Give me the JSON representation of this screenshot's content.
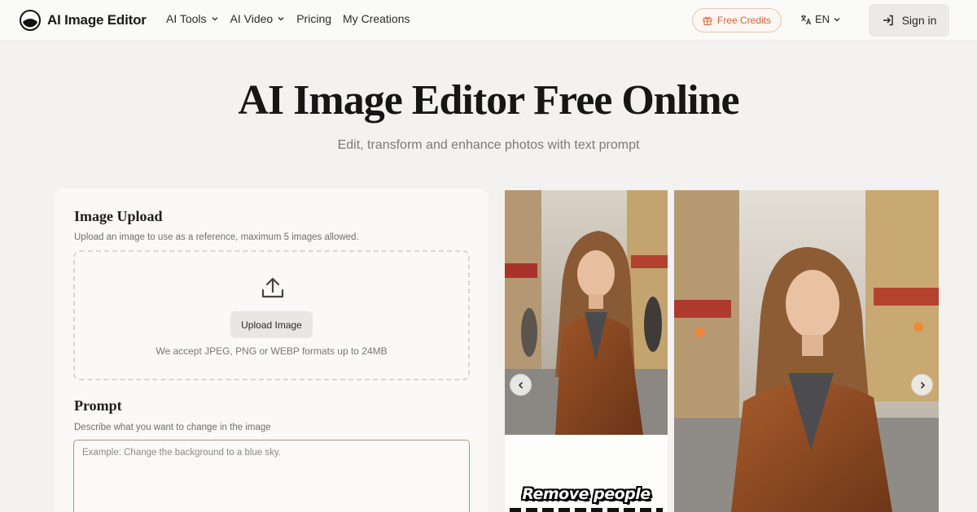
{
  "header": {
    "brand_name": "AI Image Editor",
    "nav": [
      {
        "label": "AI Tools",
        "has_dropdown": true
      },
      {
        "label": "AI Video",
        "has_dropdown": true
      },
      {
        "label": "Pricing",
        "has_dropdown": false
      },
      {
        "label": "My Creations",
        "has_dropdown": false
      }
    ],
    "credits_label": "Free Credits",
    "language": "EN",
    "signin_label": "Sign in"
  },
  "hero": {
    "title": "AI Image Editor Free Online",
    "subtitle": "Edit, transform and enhance photos with text prompt"
  },
  "upload": {
    "title": "Image Upload",
    "description": "Upload an image to use as a reference, maximum 5 images allowed.",
    "button_label": "Upload Image",
    "formats_note": "We accept JPEG, PNG or WEBP formats up to 24MB"
  },
  "prompt": {
    "title": "Prompt",
    "description": "Describe what you want to change in the image",
    "placeholder": "Example: Change the background to a blue sky."
  },
  "gallery": {
    "caption": "Remove people"
  },
  "icons": {
    "logo": "logo-icon",
    "gift": "gift-icon",
    "translate": "translate-icon",
    "signin": "sign-in-icon",
    "upload": "upload-icon",
    "prev": "chevron-left-icon",
    "next": "chevron-right-icon"
  },
  "colors": {
    "background": "#f3f2f0",
    "accent": "#d9643a",
    "prompt_border": "#b9926f"
  }
}
